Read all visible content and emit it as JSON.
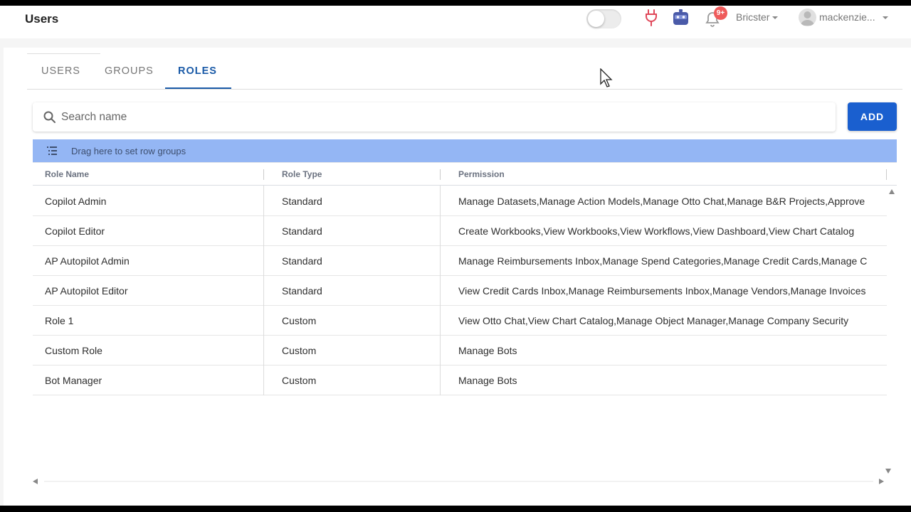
{
  "header": {
    "title": "Users",
    "toggle_state": "off",
    "icons": [
      "plug-icon",
      "bot-icon",
      "bell-icon"
    ],
    "notification_badge": "9+",
    "company": "Bricster",
    "user": "mackenzie..."
  },
  "tabs": [
    {
      "label": "USERS",
      "active": false
    },
    {
      "label": "GROUPS",
      "active": false
    },
    {
      "label": "ROLES",
      "active": true
    }
  ],
  "search": {
    "placeholder": "Search name",
    "value": ""
  },
  "add_label": "ADD",
  "group_bar": {
    "text": "Drag here to set row groups"
  },
  "table": {
    "columns": [
      "Role Name",
      "Role Type",
      "Permission"
    ],
    "rows": [
      {
        "name": "Copilot Admin",
        "type": "Standard",
        "permission": "Manage Datasets,Manage Action Models,Manage Otto Chat,Manage B&R Projects,Approve"
      },
      {
        "name": "Copilot Editor",
        "type": "Standard",
        "permission": "Create Workbooks,View Workbooks,View Workflows,View Dashboard,View Chart Catalog"
      },
      {
        "name": "AP Autopilot Admin",
        "type": "Standard",
        "permission": "Manage Reimbursements Inbox,Manage Spend Categories,Manage Credit Cards,Manage C"
      },
      {
        "name": "AP Autopilot Editor",
        "type": "Standard",
        "permission": "View Credit Cards Inbox,Manage Reimbursements Inbox,Manage Vendors,Manage Invoices"
      },
      {
        "name": "Role 1",
        "type": "Custom",
        "permission": "View Otto Chat,View Chart Catalog,Manage Object Manager,Manage Company Security"
      },
      {
        "name": "Custom Role",
        "type": "Custom",
        "permission": "Manage Bots"
      },
      {
        "name": "Bot Manager",
        "type": "Custom",
        "permission": "Manage Bots"
      }
    ]
  },
  "colors": {
    "accent": "#1a5aa7",
    "add_button": "#1a5fcf",
    "group_bar": "#94b6f4",
    "badge": "#ef5b5b"
  }
}
